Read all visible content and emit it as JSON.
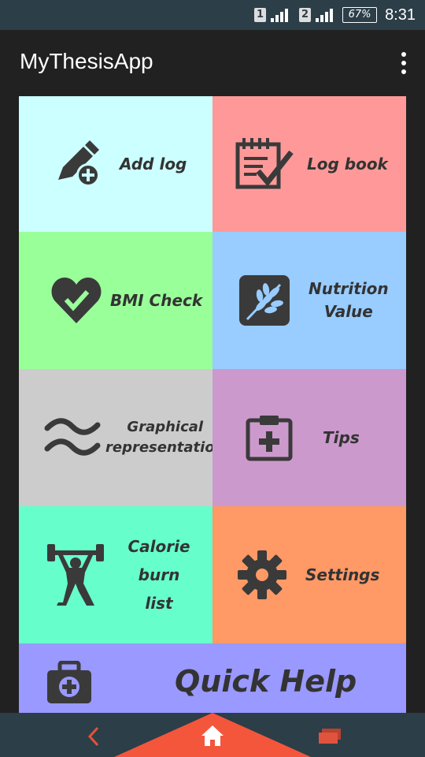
{
  "status_bar": {
    "sim1": "1",
    "sim2": "2",
    "battery": "67%",
    "time": "8:31"
  },
  "app_bar": {
    "title": "MyThesisApp",
    "overflow_icon": "more-vert-icon"
  },
  "tiles": {
    "add_log": {
      "label": "Add log",
      "icon": "pencil-add-icon",
      "color": "#ccffff"
    },
    "log_book": {
      "label": "Log book",
      "icon": "notepad-check-icon",
      "color": "#ff9999"
    },
    "bmi_check": {
      "label": "BMI Check",
      "icon": "heart-check-icon",
      "color": "#99ff99"
    },
    "nutrition_value": {
      "label_line1": "Nutrition",
      "label_line2": "Value",
      "icon": "wheat-icon",
      "color": "#99ccff"
    },
    "graphical": {
      "label_line1": "Graphical",
      "label_line2": "representation",
      "icon": "wave-icon",
      "color": "#cccccc"
    },
    "tips": {
      "label": "Tips",
      "icon": "clipboard-plus-icon",
      "color": "#cc99cc"
    },
    "calorie": {
      "label_line1": "Calorie burn",
      "label_line2": "list",
      "icon": "weightlifter-icon",
      "color": "#66ffcc"
    },
    "settings": {
      "label": "Settings",
      "icon": "gear-icon",
      "color": "#ff9966"
    },
    "quick_help": {
      "label": "Quick Help",
      "icon": "first-aid-kit-icon",
      "color": "#9999ff"
    }
  },
  "nav_bar": {
    "back_icon": "back-chevron-icon",
    "home_icon": "home-icon",
    "recents_icon": "recent-apps-icon",
    "accent": "#f4563c"
  }
}
